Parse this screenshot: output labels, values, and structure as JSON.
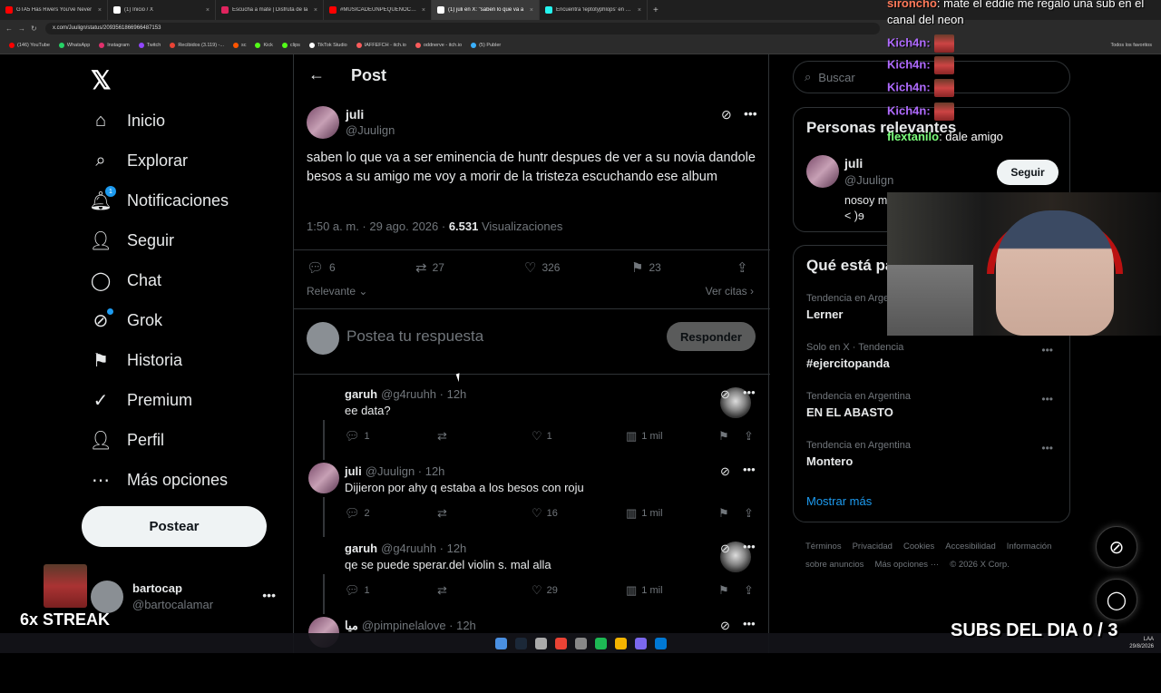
{
  "browser": {
    "tabs": [
      {
        "title": "GTA5 Has Rivers You've Never",
        "color": "#ff0000"
      },
      {
        "title": "(1) Inicio / X",
        "color": "#ffffff"
      },
      {
        "title": "Escucha a mate | Disfruta de la",
        "color": "#e0245e"
      },
      {
        "title": "#MÚSICADEUNPEQUEÑOCUA",
        "color": "#ff0000"
      },
      {
        "title": "(1) juli en X: \"saben lo que va a",
        "color": "#ffffff"
      },
      {
        "title": "Encuentra 'leptotyphlops' en TikT",
        "color": "#25f4ee"
      }
    ],
    "url": "x.com/Juulign/status/2093561866966487153",
    "bookmarks": [
      {
        "label": "(146) YouTube",
        "color": "#ff0000"
      },
      {
        "label": "WhatsApp",
        "color": "#25d366"
      },
      {
        "label": "Instagram",
        "color": "#e1306c"
      },
      {
        "label": "Twitch",
        "color": "#9146ff"
      },
      {
        "label": "Recibidos (3.119) -...",
        "color": "#ea4335"
      },
      {
        "label": "sc",
        "color": "#ff5500"
      },
      {
        "label": "Kick",
        "color": "#53fc18"
      },
      {
        "label": "clips",
        "color": "#53fc18"
      },
      {
        "label": "TikTok Studio",
        "color": "#ffffff"
      },
      {
        "label": "IAFFEFCH - itch.io",
        "color": "#fa5c5c"
      },
      {
        "label": "oddnerve - itch.io",
        "color": "#fa5c5c"
      },
      {
        "label": "(5) Publer",
        "color": "#3ab0ff"
      }
    ],
    "bookmarks_right": "Todos los favoritos"
  },
  "nav": {
    "items": [
      {
        "label": "Inicio",
        "icon": "home-icon"
      },
      {
        "label": "Explorar",
        "icon": "search-icon"
      },
      {
        "label": "Notificaciones",
        "icon": "bell-icon",
        "badge": "1"
      },
      {
        "label": "Seguir",
        "icon": "follow-icon"
      },
      {
        "label": "Chat",
        "icon": "chat-icon"
      },
      {
        "label": "Grok",
        "icon": "grok-icon"
      },
      {
        "label": "Historia",
        "icon": "bookmark-icon"
      },
      {
        "label": "Premium",
        "icon": "verified-icon"
      },
      {
        "label": "Perfil",
        "icon": "profile-icon"
      },
      {
        "label": "Más opciones",
        "icon": "more-icon"
      }
    ],
    "post_button": "Postear",
    "account": {
      "name": "bartocap",
      "handle": "@bartocalamar"
    }
  },
  "overlay": {
    "streak": "6x STREAK",
    "subs": "SUBS DEL DIA 0 / 3",
    "chat": [
      {
        "user": "sironcho",
        "msg": ": mate el eddie me regalo una sub en el"
      },
      {
        "user": "",
        "msg": "canal del neon"
      },
      {
        "user": "Kich4n:",
        "msg": ""
      },
      {
        "user": "Kich4n:",
        "msg": ""
      },
      {
        "user": "Kich4n:",
        "msg": ""
      },
      {
        "user": "Kich4n:",
        "msg": ""
      },
      {
        "user": "flextanilo",
        "msg": ": dale amigo"
      }
    ]
  },
  "post": {
    "header": "Post",
    "author": "juli",
    "handle": "@Juulign",
    "text": "saben lo que va a ser eminencia de huntr despues de ver a su novia dandole besos a su amigo me voy a morir de la tristeza escuchando ese album",
    "time": "1:50 a. m. · 29 ago. 2026 · ",
    "views": "6.531",
    "views_label": " Visualizaciones",
    "replies": "6",
    "reposts": "27",
    "likes": "326",
    "bookmarks": "23",
    "sort": "Relevante",
    "quotes": "Ver citas",
    "reply_placeholder": "Postea tu respuesta",
    "reply_button": "Responder"
  },
  "comments": [
    {
      "name": "garuh",
      "handle": "@g4ruuhh · 12h",
      "text": "ee data?",
      "replies": "1",
      "likes": "1",
      "views": "1 mil",
      "avatar": "garuh"
    },
    {
      "name": "juli",
      "handle": "@Juulign · 12h",
      "text": "Dijieron por ahy q estaba a los besos con roju",
      "replies": "2",
      "likes": "16",
      "views": "1 mil",
      "avatar": "juli"
    },
    {
      "name": "garuh",
      "handle": "@g4ruuhh · 12h",
      "text": "qe se puede sperar.del violin s. mal alla",
      "replies": "1",
      "likes": "29",
      "views": "1 mil",
      "avatar": "garuh"
    },
    {
      "name": "ميا",
      "handle": "@pimpinelalove · 12h",
      "text": "",
      "replies": "",
      "likes": "",
      "views": "",
      "avatar": "juli"
    }
  ],
  "sidebar": {
    "search_placeholder": "Buscar",
    "relevant": {
      "title": "Personas relevantes",
      "name": "juli",
      "handle": "@Juulign",
      "follow": "Seguir",
      "bio": "nosoy malo eso ya esta en mi sangre ɘ(> - < )ɘ"
    },
    "trends_title": "Qué está pasando",
    "trends": [
      {
        "category": "Tendencia en Argentina",
        "name": "Lerner"
      },
      {
        "category": "Solo en X · Tendencia",
        "name": "#ejercitopanda"
      },
      {
        "category": "Tendencia en Argentina",
        "name": "EN EL ABASTO"
      },
      {
        "category": "Tendencia en Argentina",
        "name": "Montero"
      }
    ],
    "show_more": "Mostrar más",
    "footer": [
      "Términos",
      "Privacidad",
      "Cookies",
      "Accesibilidad",
      "Información sobre anuncios",
      "Más opciones ···",
      "© 2026 X Corp."
    ]
  },
  "taskbar": {
    "clock": "LAA",
    "date": "29/8/2026"
  }
}
